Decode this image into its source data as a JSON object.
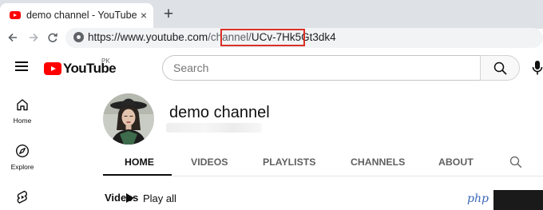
{
  "browser": {
    "tab_title": "demo channel - YouTube",
    "tab_close": "×",
    "new_tab": "+",
    "url_host": "https://www.youtube.com",
    "url_path": "/channel/",
    "url_id": "UCv-7Hk5Gt3dk4"
  },
  "youtube": {
    "logo_text": "YouTube",
    "region": "PK",
    "search_placeholder": "Search",
    "brand_color": "#ff0000"
  },
  "guide": {
    "items": [
      {
        "label": "Home",
        "icon": "home-icon"
      },
      {
        "label": "Explore",
        "icon": "explore-icon"
      },
      {
        "label": "",
        "icon": "shorts-icon"
      }
    ]
  },
  "channel": {
    "name": "demo channel",
    "tabs": [
      "HOME",
      "VIDEOS",
      "PLAYLISTS",
      "CHANNELS",
      "ABOUT"
    ],
    "active_tab": "HOME"
  },
  "section": {
    "title": "Videos",
    "play_all": "Play all"
  },
  "watermark": {
    "text": "php"
  }
}
